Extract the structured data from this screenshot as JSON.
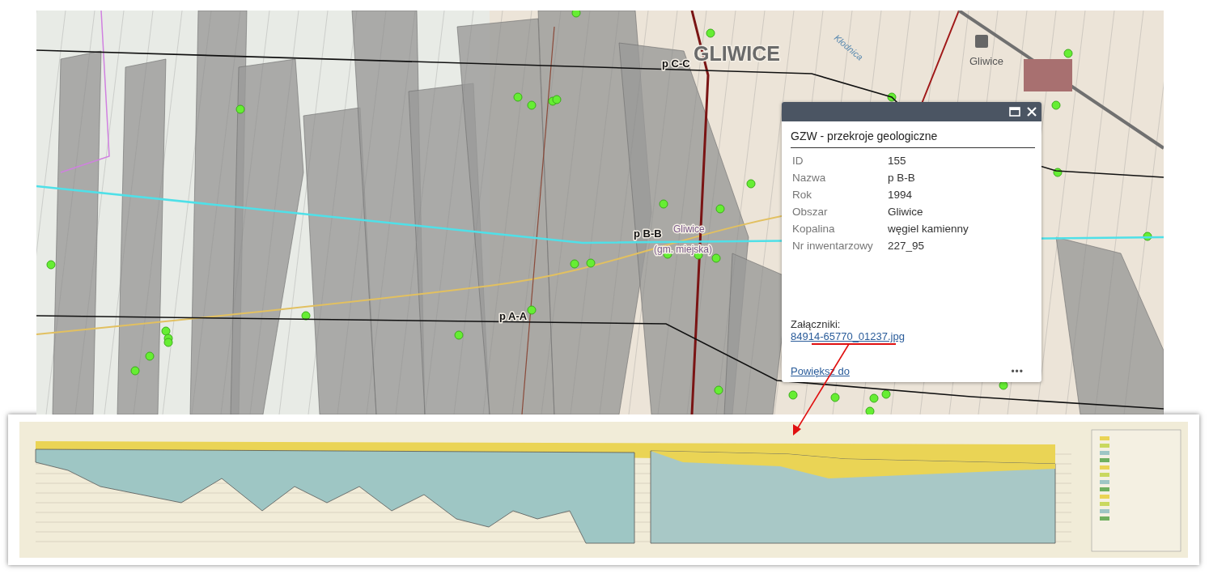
{
  "map": {
    "place_labels": [
      {
        "kind": "city",
        "text": "GLIWICE"
      },
      {
        "kind": "station",
        "text": "Gliwice"
      },
      {
        "kind": "town",
        "text": "Gliwice"
      },
      {
        "kind": "town",
        "text": "(gm. miejska)"
      },
      {
        "kind": "river",
        "text": "Kłodnica"
      }
    ],
    "section_lines": [
      {
        "label": "p C-C",
        "selected": false
      },
      {
        "label": "p B-B",
        "selected": true
      },
      {
        "label": "p A-A",
        "selected": false
      }
    ]
  },
  "popup": {
    "title": "GZW - przekroje geologiczne",
    "fields": [
      {
        "label": "ID",
        "value": "155"
      },
      {
        "label": "Nazwa",
        "value": "p B-B"
      },
      {
        "label": "Rok",
        "value": "1994"
      },
      {
        "label": "Obszar",
        "value": "Gliwice"
      },
      {
        "label": "Kopalina",
        "value": "węgiel kamienny"
      },
      {
        "label": "Nr inwentarzowy",
        "value": "227_95"
      }
    ],
    "attachments_label": "Załączniki:",
    "attachment": "84914-65770_01237.jpg",
    "zoom_link": "Powiększ do",
    "more": "•••"
  }
}
